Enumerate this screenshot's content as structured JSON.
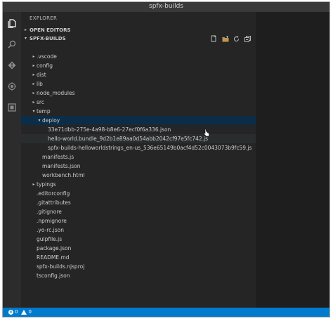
{
  "window": {
    "title": "spfx-builds"
  },
  "sidebar": {
    "title": "EXPLORER",
    "open_editors_label": "OPEN EDITORS",
    "project_label": "SPFX-BUILDS"
  },
  "toolbar": {
    "icons": [
      "new-file-icon",
      "new-folder-icon",
      "refresh-icon",
      "collapse-all-icon"
    ]
  },
  "tree": [
    {
      "label": ".vscode",
      "kind": "folder",
      "expanded": false
    },
    {
      "label": "config",
      "kind": "folder",
      "expanded": false
    },
    {
      "label": "dist",
      "kind": "folder",
      "expanded": false
    },
    {
      "label": "lib",
      "kind": "folder",
      "expanded": false
    },
    {
      "label": "node_modules",
      "kind": "folder",
      "expanded": false
    },
    {
      "label": "src",
      "kind": "folder",
      "expanded": false
    },
    {
      "label": "temp",
      "kind": "folder",
      "expanded": true
    },
    {
      "label": "deploy",
      "kind": "folder",
      "expanded": true,
      "selected": true
    },
    {
      "label": "33e71dbb-275e-4a98-b8e6-27ecf0f6a336.json",
      "kind": "file"
    },
    {
      "label": "hello-world.bundle_9d2b1e89aa0d54abb2042cf97e5fc742.js",
      "kind": "file",
      "hover": true
    },
    {
      "label": "spfx-builds-helloworldstrings_en-us_536e65149b0acf4d52c0043073b9fc59.js",
      "kind": "file"
    },
    {
      "label": "manifests.js",
      "kind": "file"
    },
    {
      "label": "manifests.json",
      "kind": "file"
    },
    {
      "label": "workbench.html",
      "kind": "file"
    },
    {
      "label": "typings",
      "kind": "folder",
      "expanded": false
    },
    {
      "label": ".editorconfig",
      "kind": "file"
    },
    {
      "label": ".gitattributes",
      "kind": "file"
    },
    {
      "label": ".gitignore",
      "kind": "file"
    },
    {
      "label": ".npmignore",
      "kind": "file"
    },
    {
      "label": ".yo-rc.json",
      "kind": "file"
    },
    {
      "label": "gulpfile.js",
      "kind": "file"
    },
    {
      "label": "package.json",
      "kind": "file"
    },
    {
      "label": "README.md",
      "kind": "file"
    },
    {
      "label": "spfx-builds.njsproj",
      "kind": "file"
    },
    {
      "label": "tsconfig.json",
      "kind": "file"
    }
  ],
  "statusbar": {
    "errors": "0",
    "warnings": "0"
  },
  "colors": {
    "accent": "#007acc",
    "selection": "#0b2d48",
    "sidebar_bg": "#252526",
    "activity_bg": "#2c2c2c"
  }
}
